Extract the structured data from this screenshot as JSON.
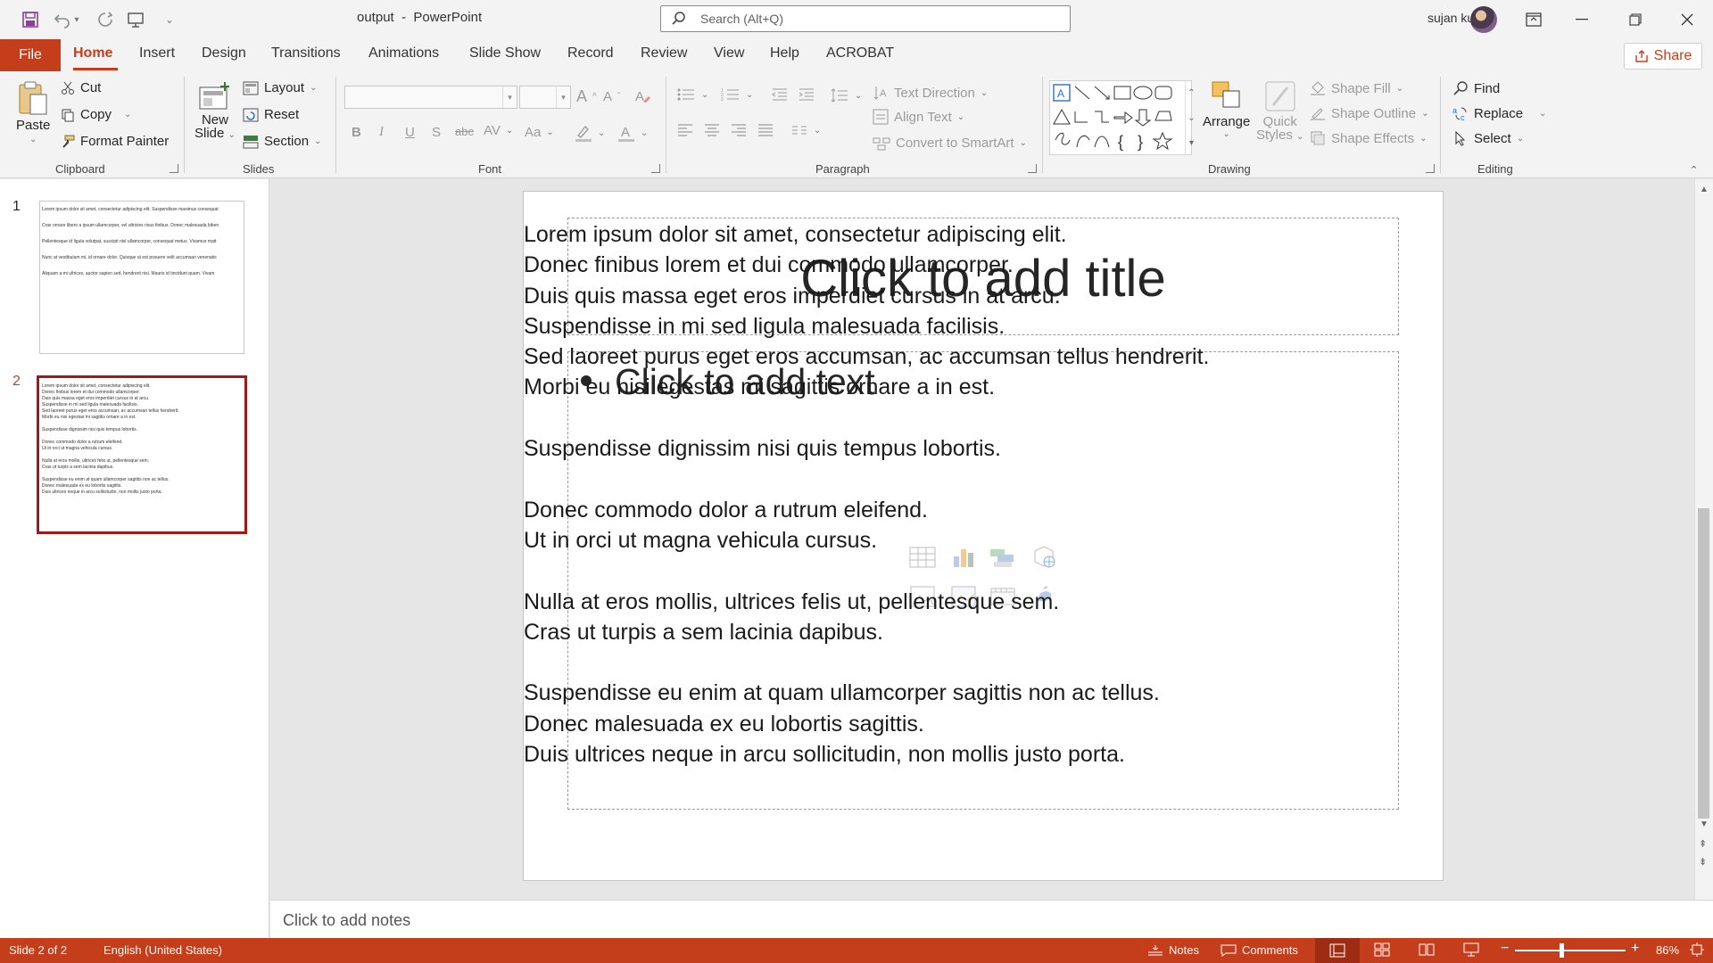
{
  "window": {
    "doc_name": "output",
    "separator": "-",
    "app_name": "PowerPoint",
    "search_placeholder": "Search (Alt+Q)",
    "user": "sujan kumar"
  },
  "tabs": [
    "File",
    "Home",
    "Insert",
    "Design",
    "Transitions",
    "Animations",
    "Slide Show",
    "Record",
    "Review",
    "View",
    "Help",
    "ACROBAT"
  ],
  "share_label": "Share",
  "ribbon": {
    "clipboard": {
      "paste": "Paste",
      "cut": "Cut",
      "copy": "Copy",
      "format_painter": "Format Painter",
      "label": "Clipboard"
    },
    "slides": {
      "new_slide_1": "New",
      "new_slide_2": "Slide",
      "layout": "Layout",
      "reset": "Reset",
      "section": "Section",
      "label": "Slides"
    },
    "font": {
      "label": "Font",
      "bold": "B",
      "italic": "I",
      "underline": "U",
      "shadow": "S",
      "strike": "abc",
      "spacing": "AV",
      "case": "Aa",
      "grow": "A",
      "shrink": "A"
    },
    "paragraph": {
      "text_direction": "Text Direction",
      "align_text": "Align Text",
      "convert_smartart": "Convert to SmartArt",
      "label": "Paragraph"
    },
    "drawing": {
      "arrange": "Arrange",
      "quick_styles_1": "Quick",
      "quick_styles_2": "Styles",
      "shape_fill": "Shape Fill",
      "shape_outline": "Shape Outline",
      "shape_effects": "Shape Effects",
      "label": "Drawing"
    },
    "editing": {
      "find": "Find",
      "replace": "Replace",
      "select": "Select",
      "label": "Editing"
    }
  },
  "thumbnails": [
    {
      "number": "1",
      "lines": [
        "Lorem ipsum dolor sit amet, consectetur adipiscing elit. Suspendisse maximus consequat",
        "Cras ornare libero a ipsum ullamcorper, vel ultricies risus finibus. Donec malesuada biben",
        "Pellentesque id ligula volutpat, suscipit nisl ullamcorper, consequat metus. Vivamus matt",
        "Nunc at vestibulum mi, id ornare dolor. Quisque ut est posuere velit accumsan venenatis",
        "Aliquam a mi ultrices, auctor sapien sed, hendrerit nisi. Mauris id tincidunt quam. Vivam"
      ]
    },
    {
      "number": "2",
      "lines": [
        "Lorem ipsum dolor sit amet, consectetur adipiscing elit.",
        "Donec finibus lorem et dui commodo ullamcorper.",
        "Duis quis massa eget eros imperdiet cursus in at arcu.",
        "Suspendisse in mi sed ligula malesuada facilisis.",
        "Sed laoreet purus eget eros accumsan, ac accumsan tellus hendrerit.",
        "Morbi eu nisi egestas mi sagittis ornare a in est.",
        "",
        "Suspendisse dignissim nisi quis tempus lobortis.",
        "",
        "Donec commodo dolor a rutrum eleifend.",
        "Ut in orci ut magna vehicula cursus.",
        "",
        "Nulla at eros mollis, ultrices felis ut, pellentesque sem.",
        "Cras ut turpis a sem lacinia dapibus.",
        "",
        "Suspendisse eu enim at quam ullamcorper sagittis non ac tellus.",
        "Donec malesuada ex eu lobortis sagittis.",
        "Duis ultrices neque in arcu sollicitudin, non mollis justo porta."
      ]
    }
  ],
  "slide": {
    "title_placeholder": "Click to add title",
    "body_placeholder": "Click to add text",
    "overlay_text": "Lorem ipsum dolor sit amet, consectetur adipiscing elit.\nDonec finibus lorem et dui commodo ullamcorper.\nDuis quis massa eget eros imperdiet cursus in at arcu.\nSuspendisse in mi sed ligula malesuada facilisis.\nSed laoreet purus eget eros accumsan, ac accumsan tellus hendrerit.\nMorbi eu nisi egestas mi sagittis ornare a in est.\n\nSuspendisse dignissim nisi quis tempus lobortis.\n\nDonec commodo dolor a rutrum eleifend.\nUt in orci ut magna vehicula cursus.\n\nNulla at eros mollis, ultrices felis ut, pellentesque sem.\nCras ut turpis a sem lacinia dapibus.\n\nSuspendisse eu enim at quam ullamcorper sagittis non ac tellus.\nDonec malesuada ex eu lobortis sagittis.\nDuis ultrices neque in arcu sollicitudin, non mollis justo porta."
  },
  "notes_placeholder": "Click to add notes",
  "status": {
    "slide_info": "Slide 2 of 2",
    "language": "English (United States)",
    "notes": "Notes",
    "comments": "Comments",
    "zoom": "86%"
  },
  "colors": {
    "accent": "#c43e1c",
    "selected_thumb_border": "#9e1a1a"
  }
}
